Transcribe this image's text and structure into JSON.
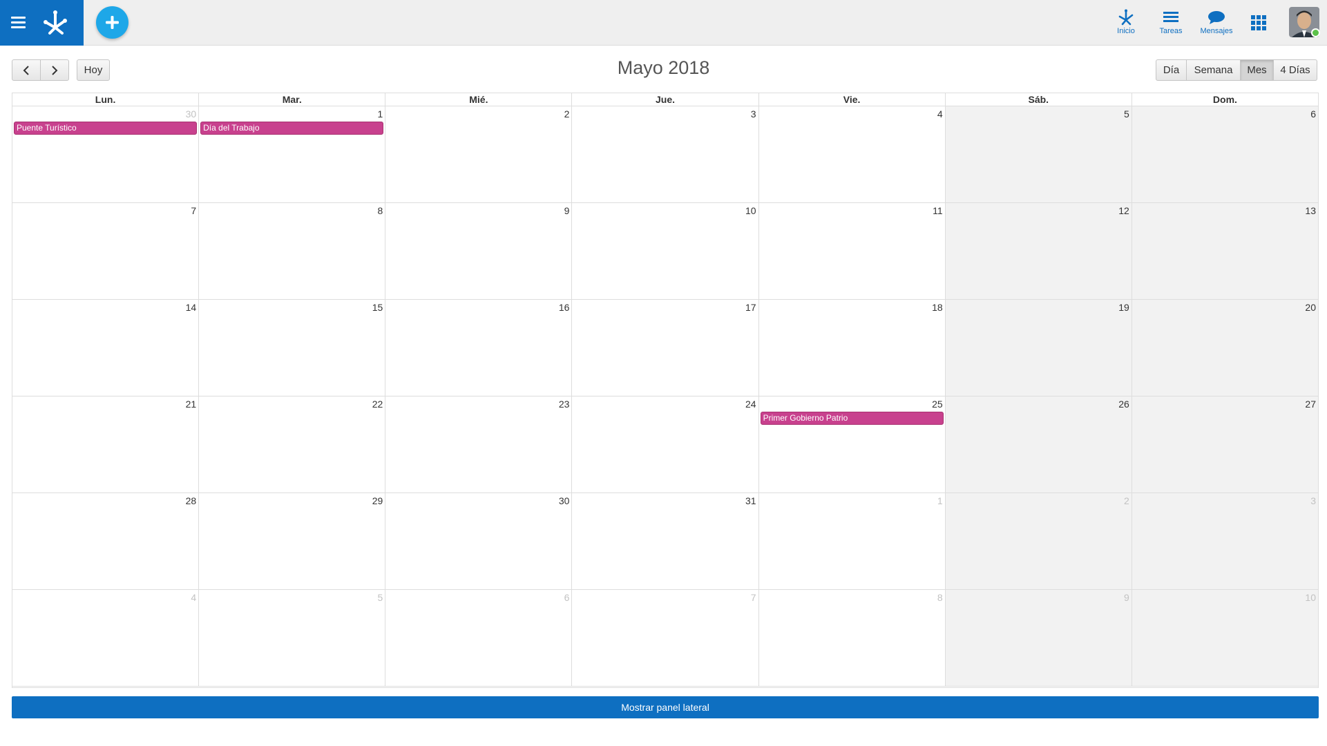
{
  "topbar": {
    "nav": [
      {
        "label": "Inicio",
        "icon": "home-icon"
      },
      {
        "label": "Tareas",
        "icon": "tasks-icon"
      },
      {
        "label": "Mensajes",
        "icon": "messages-icon"
      }
    ],
    "accent_color": "#0e6fc1",
    "add_button_color": "#1ea7e8",
    "user_status": "online"
  },
  "toolbar": {
    "today_label": "Hoy",
    "title": "Mayo 2018",
    "views": [
      "Día",
      "Semana",
      "Mes",
      "4 Días"
    ],
    "active_view": "Mes"
  },
  "calendar": {
    "day_headers": [
      "Lun.",
      "Mar.",
      "Mié.",
      "Jue.",
      "Vie.",
      "Sáb.",
      "Dom."
    ],
    "weeks": [
      [
        {
          "n": "30",
          "other": true
        },
        {
          "n": "1"
        },
        {
          "n": "2"
        },
        {
          "n": "3"
        },
        {
          "n": "4"
        },
        {
          "n": "5"
        },
        {
          "n": "6"
        }
      ],
      [
        {
          "n": "7"
        },
        {
          "n": "8"
        },
        {
          "n": "9"
        },
        {
          "n": "10"
        },
        {
          "n": "11"
        },
        {
          "n": "12"
        },
        {
          "n": "13"
        }
      ],
      [
        {
          "n": "14"
        },
        {
          "n": "15"
        },
        {
          "n": "16"
        },
        {
          "n": "17"
        },
        {
          "n": "18"
        },
        {
          "n": "19"
        },
        {
          "n": "20"
        }
      ],
      [
        {
          "n": "21"
        },
        {
          "n": "22"
        },
        {
          "n": "23"
        },
        {
          "n": "24"
        },
        {
          "n": "25"
        },
        {
          "n": "26"
        },
        {
          "n": "27"
        }
      ],
      [
        {
          "n": "28"
        },
        {
          "n": "29"
        },
        {
          "n": "30"
        },
        {
          "n": "31"
        },
        {
          "n": "1",
          "other": true
        },
        {
          "n": "2",
          "other": true
        },
        {
          "n": "3",
          "other": true
        }
      ],
      [
        {
          "n": "4",
          "other": true
        },
        {
          "n": "5",
          "other": true
        },
        {
          "n": "6",
          "other": true
        },
        {
          "n": "7",
          "other": true
        },
        {
          "n": "8",
          "other": true
        },
        {
          "n": "9",
          "other": true
        },
        {
          "n": "10",
          "other": true
        }
      ]
    ],
    "events": [
      {
        "title": "Puente Turístico",
        "week": 0,
        "day": 0
      },
      {
        "title": "Día del Trabajo",
        "week": 0,
        "day": 1
      },
      {
        "title": "Primer Gobierno Patrio",
        "week": 3,
        "day": 4
      }
    ],
    "event_color": "#c8418e",
    "weekend_color": "#f2f2f2"
  },
  "footer": {
    "side_panel_label": "Mostrar panel lateral"
  }
}
